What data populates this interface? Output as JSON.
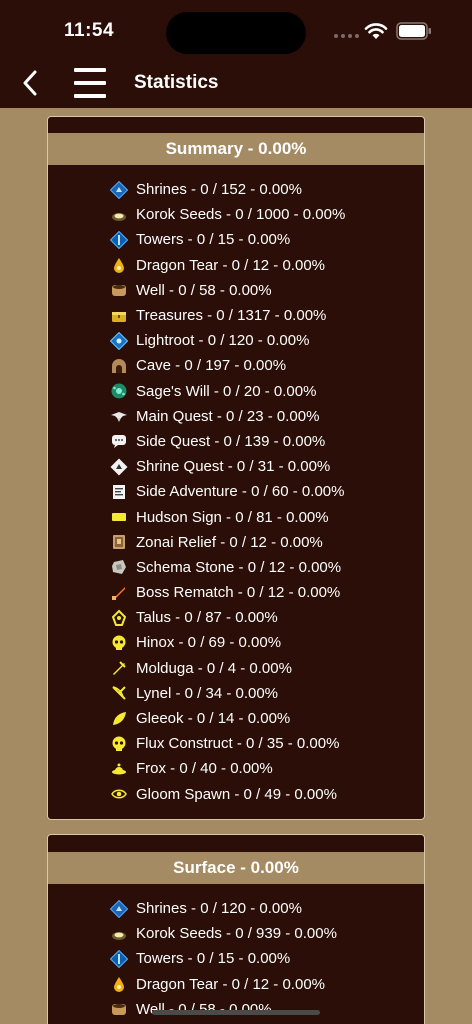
{
  "status_bar": {
    "time": "11:54"
  },
  "nav": {
    "title": "Statistics"
  },
  "colors": {
    "background": "#a58b64",
    "panel": "#2a0e07",
    "header_band": "#a58b64"
  },
  "sections": [
    {
      "title": "Summary - 0.00%",
      "rows": [
        {
          "icon": "shrine-icon",
          "label": "Shrines - 0 / 152 - 0.00%"
        },
        {
          "icon": "korok-seed-icon",
          "label": "Korok Seeds - 0 / 1000 - 0.00%"
        },
        {
          "icon": "tower-icon",
          "label": "Towers - 0 / 15 - 0.00%"
        },
        {
          "icon": "dragon-tear-icon",
          "label": "Dragon Tear - 0 / 12 - 0.00%"
        },
        {
          "icon": "well-icon",
          "label": "Well - 0 / 58 - 0.00%"
        },
        {
          "icon": "treasure-icon",
          "label": "Treasures - 0 / 1317 - 0.00%"
        },
        {
          "icon": "lightroot-icon",
          "label": "Lightroot - 0 / 120 - 0.00%"
        },
        {
          "icon": "cave-icon",
          "label": "Cave - 0 / 197 - 0.00%"
        },
        {
          "icon": "sages-will-icon",
          "label": "Sage's Will - 0 / 20 - 0.00%"
        },
        {
          "icon": "main-quest-icon",
          "label": "Main Quest - 0 / 23 - 0.00%"
        },
        {
          "icon": "side-quest-icon",
          "label": "Side Quest - 0 / 139 - 0.00%"
        },
        {
          "icon": "shrine-quest-icon",
          "label": "Shrine Quest - 0 / 31 - 0.00%"
        },
        {
          "icon": "side-adventure-icon",
          "label": "Side Adventure - 0 / 60 - 0.00%"
        },
        {
          "icon": "hudson-sign-icon",
          "label": "Hudson Sign - 0 / 81 - 0.00%"
        },
        {
          "icon": "zonai-relief-icon",
          "label": "Zonai Relief - 0 / 12 - 0.00%"
        },
        {
          "icon": "schema-stone-icon",
          "label": "Schema Stone - 0 / 12 - 0.00%"
        },
        {
          "icon": "boss-rematch-icon",
          "label": "Boss Rematch - 0 / 12 - 0.00%"
        },
        {
          "icon": "talus-icon",
          "label": "Talus - 0 / 87 - 0.00%"
        },
        {
          "icon": "hinox-icon",
          "label": "Hinox - 0 / 69 - 0.00%"
        },
        {
          "icon": "molduga-icon",
          "label": "Molduga - 0 / 4 - 0.00%"
        },
        {
          "icon": "lynel-icon",
          "label": "Lynel - 0 / 34 - 0.00%"
        },
        {
          "icon": "gleeok-icon",
          "label": "Gleeok - 0 / 14 - 0.00%"
        },
        {
          "icon": "flux-construct-icon",
          "label": "Flux Construct - 0 / 35 - 0.00%"
        },
        {
          "icon": "frox-icon",
          "label": "Frox - 0 / 40 - 0.00%"
        },
        {
          "icon": "gloom-spawn-icon",
          "label": "Gloom Spawn - 0 / 49 - 0.00%"
        }
      ]
    },
    {
      "title": "Surface - 0.00%",
      "rows": [
        {
          "icon": "shrine-icon",
          "label": "Shrines - 0 / 120 - 0.00%"
        },
        {
          "icon": "korok-seed-icon",
          "label": "Korok Seeds - 0 / 939 - 0.00%"
        },
        {
          "icon": "tower-icon",
          "label": "Towers - 0 / 15 - 0.00%"
        },
        {
          "icon": "dragon-tear-icon",
          "label": "Dragon Tear - 0 / 12 - 0.00%"
        },
        {
          "icon": "well-icon",
          "label": "Well - 0 / 58 - 0.00%"
        }
      ]
    }
  ]
}
